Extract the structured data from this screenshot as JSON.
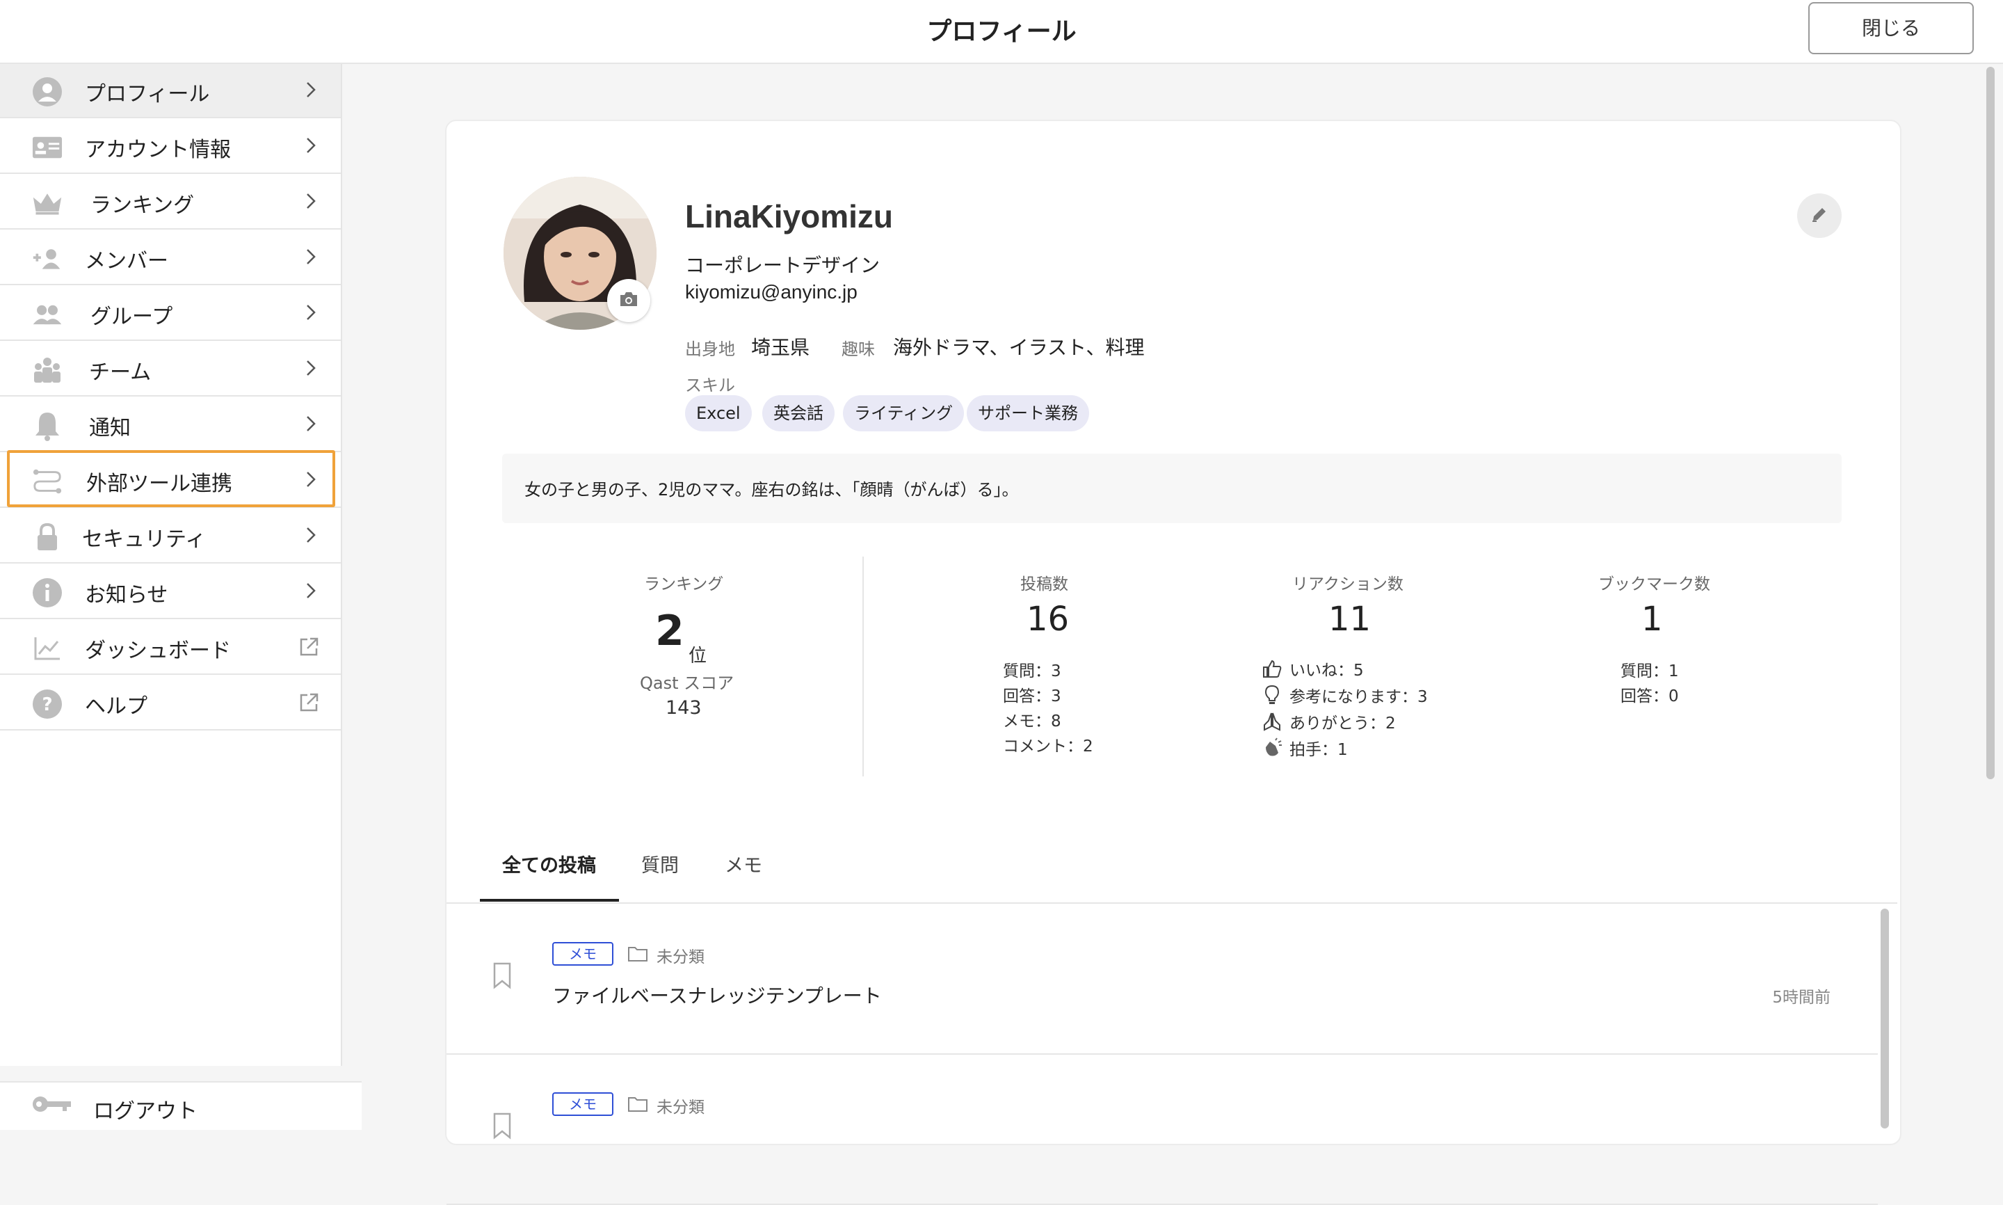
{
  "header": {
    "title": "プロフィール",
    "close_label": "閉じる"
  },
  "sidebar": {
    "items": [
      {
        "label": "プロフィール",
        "icon": "user-circle-icon"
      },
      {
        "label": "アカウント情報",
        "icon": "id-card-icon"
      },
      {
        "label": "ランキング",
        "icon": "crown-icon"
      },
      {
        "label": "メンバー",
        "icon": "add-user-icon"
      },
      {
        "label": "グループ",
        "icon": "group-icon"
      },
      {
        "label": "チーム",
        "icon": "team-icon"
      },
      {
        "label": "通知",
        "icon": "bell-icon"
      },
      {
        "label": "外部ツール連携",
        "icon": "integration-icon"
      },
      {
        "label": "セキュリティ",
        "icon": "lock-icon"
      },
      {
        "label": "お知らせ",
        "icon": "info-icon"
      },
      {
        "label": "ダッシュボード",
        "icon": "chart-icon"
      },
      {
        "label": "ヘルプ",
        "icon": "help-icon"
      }
    ],
    "logout_label": "ログアウト"
  },
  "profile": {
    "name": "LinaKiyomizu",
    "department": "コーポレートデザイン",
    "email": "kiyomizu@anyinc.jp",
    "hometown_label": "出身地",
    "hometown": "埼玉県",
    "hobby_label": "趣味",
    "hobby": "海外ドラマ、イラスト、料理",
    "skills_label": "スキル",
    "skills": [
      "Excel",
      "英会話",
      "ライティング",
      "サポート業務"
    ],
    "bio": "女の子と男の子、2児のママ。座右の銘は、「顔晴（がんば）る」。"
  },
  "stats": {
    "ranking_label": "ランキング",
    "ranking_value": "2",
    "ranking_unit": "位",
    "score_label": "Qast スコア",
    "score_value": "143",
    "posts_label": "投稿数",
    "posts_value": "16",
    "posts_breakdown": [
      "質問：3",
      "回答：3",
      "メモ：8",
      "コメント：2"
    ],
    "reactions_label": "リアクション数",
    "reactions_value": "11",
    "reactions_breakdown": [
      "いいね：5",
      "参考になります：3",
      "ありがとう：2",
      "拍手：1"
    ],
    "bookmarks_label": "ブックマーク数",
    "bookmarks_value": "1",
    "bookmarks_breakdown": [
      "質問：1",
      "回答：0"
    ]
  },
  "tabs": [
    "全ての投稿",
    "質問",
    "メモ"
  ],
  "posts": [
    {
      "badge": "メモ",
      "category": "未分類",
      "title": "ファイルベースナレッジテンプレート",
      "time": "5時間前"
    },
    {
      "badge": "メモ",
      "category": "未分類",
      "title": "",
      "time": ""
    }
  ],
  "colors": {
    "accent_blue": "#2f4fd6",
    "highlight_orange": "#f0a23a"
  }
}
